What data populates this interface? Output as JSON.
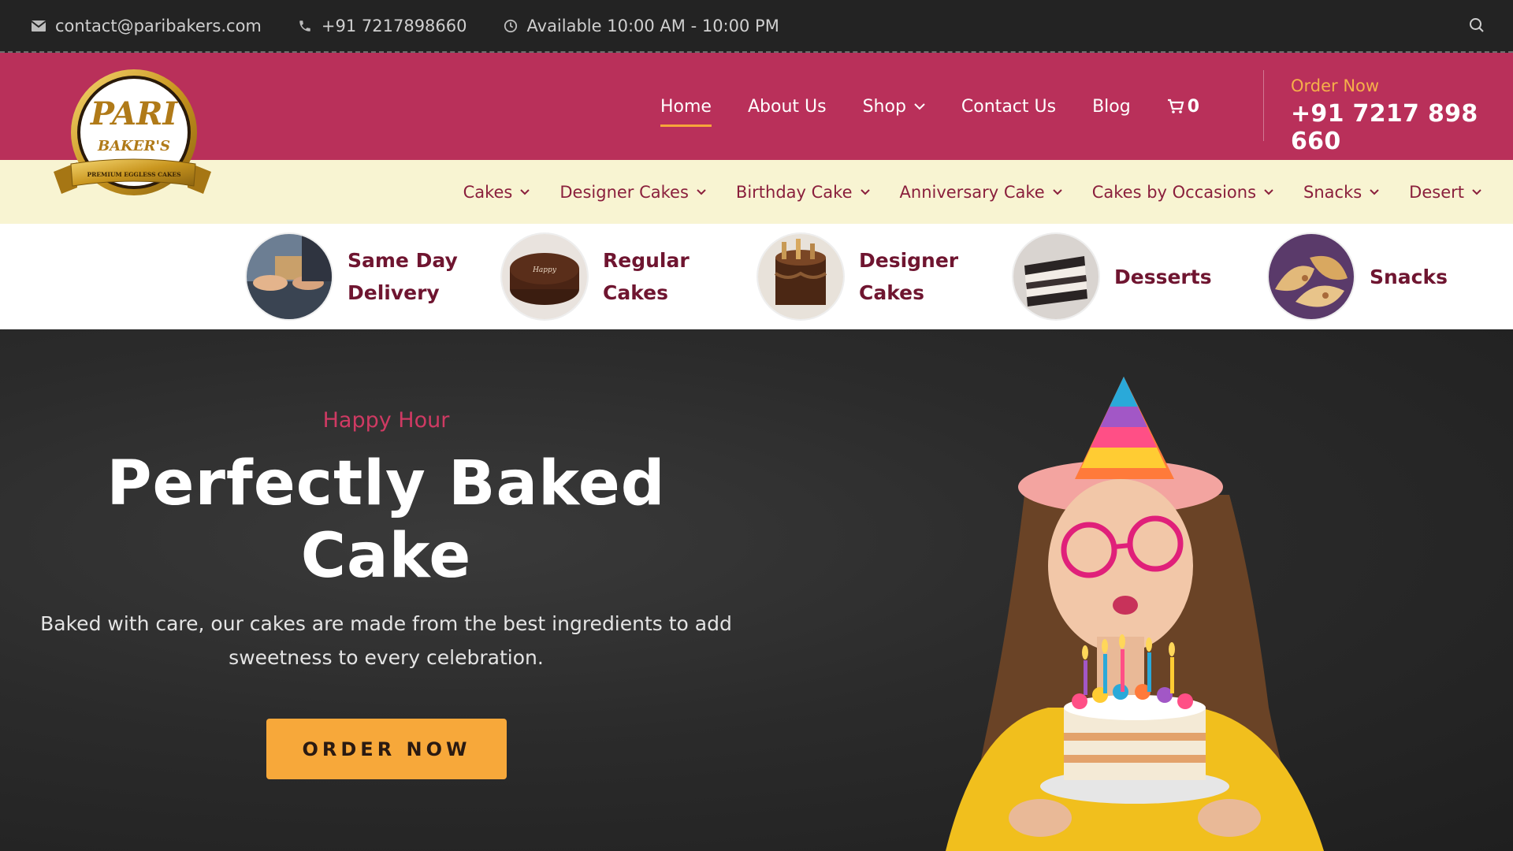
{
  "topbar": {
    "email": "contact@paribakers.com",
    "phone": "+91 7217898660",
    "hours": "Available 10:00 AM - 10:00 PM"
  },
  "logo": {
    "line1": "PARI",
    "line2": "BAKER'S",
    "ribbon": "PREMIUM EGGLESS CAKES"
  },
  "nav": {
    "items": [
      {
        "label": "Home",
        "active": true
      },
      {
        "label": "About Us"
      },
      {
        "label": "Shop",
        "dropdown": true
      },
      {
        "label": "Contact Us"
      },
      {
        "label": "Blog"
      }
    ],
    "cart_count": "0"
  },
  "order": {
    "label": "Order Now",
    "phone": "+91 7217 898 660"
  },
  "subnav": {
    "items": [
      "Cakes",
      "Designer Cakes",
      "Birthday Cake",
      "Anniversary Cake",
      "Cakes by Occasions",
      "Snacks",
      "Desert"
    ]
  },
  "categories": [
    {
      "line1": "Same Day",
      "line2": "Delivery"
    },
    {
      "line1": "Regular",
      "line2": "Cakes"
    },
    {
      "line1": "Designer",
      "line2": "Cakes"
    },
    {
      "line1": "Desserts",
      "line2": ""
    },
    {
      "line1": "Snacks",
      "line2": ""
    }
  ],
  "hero": {
    "tag": "Happy Hour",
    "title_line1": "Perfectly Baked",
    "title_line2": "Cake",
    "desc_line1": "Baked with care, our cakes are made from the best ingredients to add",
    "desc_line2": "sweetness to every celebration.",
    "button": "ORDER NOW"
  },
  "colors": {
    "header": "#b9305a",
    "subnav": "#f8f4d2",
    "accent": "#f7a83a",
    "topbar": "#232323"
  }
}
